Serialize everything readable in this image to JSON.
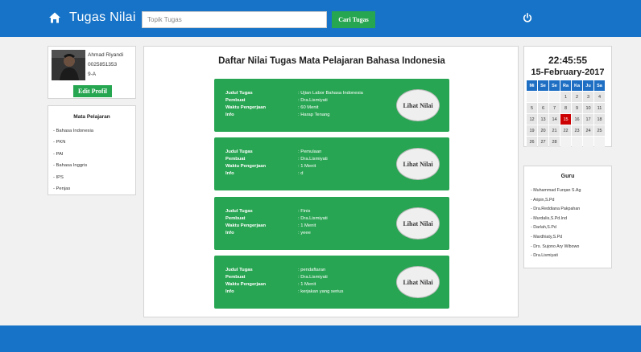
{
  "colors": {
    "header": "#1773c7",
    "green": "#28a552",
    "calendar_header": "#1e6fc4",
    "today": "#cc0000"
  },
  "header": {
    "home_icon": "home-icon",
    "title": "Tugas  Nilai",
    "search_placeholder": "Topik Tugas",
    "search_button": "Cari Tugas",
    "power_icon": "power-icon"
  },
  "profile": {
    "name": "Ahmad Riyandi",
    "nis": "0025851353",
    "class": "9-A",
    "edit_label": "Edit Profil"
  },
  "subjects": {
    "title": "Mata Pelajaran",
    "items": [
      "- Bahasa Indonesia",
      "- PKN",
      "- PAI",
      "- Bahasa Inggris",
      "- IPS",
      "- Penjas"
    ]
  },
  "main": {
    "title": "Daftar Nilai Tugas Mata Pelajaran Bahasa Indonesia",
    "field_labels": [
      "Judul Tugas",
      "Pembuat",
      "Waktu Pengerjaan",
      "Info"
    ],
    "button_label": "Lihat Nilai",
    "tasks": [
      {
        "values": [
          ": Ujian Labor Bahasa Indonesia",
          ": Dra.Lismiyati",
          ": 60 Menit",
          ": Harap Tenang"
        ]
      },
      {
        "values": [
          ": Pemulaan",
          ": Dra.Lismiyati",
          ": 1 Menit",
          ": d"
        ]
      },
      {
        "values": [
          ": Finis",
          ": Dra.Lismiyati",
          ": 1 Menit",
          ": yeee"
        ]
      },
      {
        "values": [
          ": pendaftaran",
          ": Dra.Lismiyati",
          ": 1 Menit",
          ": kerjakan yang serius"
        ]
      }
    ]
  },
  "clock": {
    "time": "22:45:55",
    "date": "15-February-2017",
    "weekdays": [
      "Mi",
      "Se",
      "Se",
      "Ra",
      "Ka",
      "Ju",
      "Sa"
    ],
    "days": [
      [
        "",
        "",
        "",
        "1",
        "2",
        "3",
        "4"
      ],
      [
        "5",
        "6",
        "7",
        "8",
        "9",
        "10",
        "11"
      ],
      [
        "12",
        "13",
        "14",
        "15",
        "16",
        "17",
        "18"
      ],
      [
        "19",
        "20",
        "21",
        "22",
        "23",
        "24",
        "25"
      ],
      [
        "26",
        "27",
        "28",
        "",
        "",
        "",
        ""
      ]
    ],
    "today": "15"
  },
  "teachers": {
    "title": "Guru",
    "items": [
      "- Muhammad Furqan S.Ag",
      "- Aripin,S.Pd",
      "- Dra.Reddiana Pakpahan",
      "- Murdalis,S.Pd.Ind",
      "- Darlah,S.Pd",
      "- Mardhiaty,S.Pd",
      "- Drs. Sujono Ary Wibowo",
      "- Dra.Lismiyati"
    ]
  }
}
